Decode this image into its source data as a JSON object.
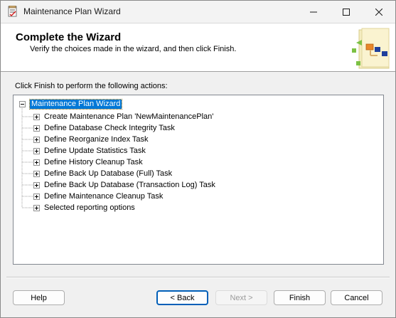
{
  "window": {
    "title": "Maintenance Plan Wizard"
  },
  "banner": {
    "title": "Complete the Wizard",
    "subtitle": "Verify the choices made in the wizard, and then click Finish."
  },
  "instruction": "Click Finish to perform the following actions:",
  "tree": {
    "root_label": "Maintenance Plan Wizard",
    "items": [
      "Create Maintenance Plan 'NewMaintenancePlan'",
      "Define Database Check Integrity Task",
      "Define Reorganize Index Task",
      "Define Update Statistics Task",
      "Define History Cleanup Task",
      "Define Back Up Database (Full) Task",
      "Define Back Up Database (Transaction Log) Task",
      "Define Maintenance Cleanup Task",
      "Selected reporting options"
    ]
  },
  "buttons": {
    "help": "Help",
    "back": "< Back",
    "next": "Next >",
    "finish": "Finish",
    "cancel": "Cancel"
  },
  "icons": {
    "app": "maintenance-plan-icon",
    "minimize": "minimize-icon",
    "maximize": "maximize-icon",
    "close": "close-icon",
    "banner": "wizard-banner-graphic",
    "expander": "plus-expander-icon",
    "collapse": "minus-collapser-icon"
  },
  "colors": {
    "selection": "#0078d7",
    "default_button_border": "#005fb8",
    "disabled_text": "#9b9b9b"
  }
}
